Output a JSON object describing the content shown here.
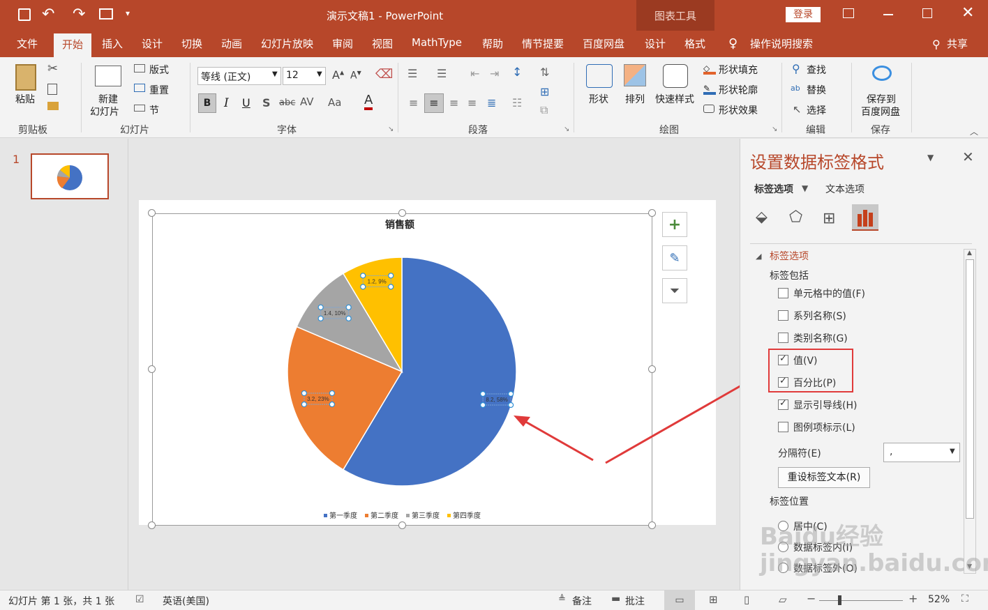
{
  "window": {
    "title": "演示文稿1  -  PowerPoint",
    "context_tools": "图表工具",
    "login": "登录"
  },
  "tabs": [
    "文件",
    "开始",
    "插入",
    "设计",
    "切换",
    "动画",
    "幻灯片放映",
    "审阅",
    "视图",
    "MathType",
    "帮助",
    "情节提要",
    "百度网盘",
    "设计",
    "格式"
  ],
  "tell_me": "操作说明搜索",
  "share": "共享",
  "ribbon": {
    "clipboard": {
      "paste": "粘贴",
      "label": "剪贴板"
    },
    "slides": {
      "new_slide_1": "新建",
      "new_slide_2": "幻灯片",
      "layout": "版式",
      "reset": "重置",
      "section": "节",
      "label": "幻灯片"
    },
    "font": {
      "font_name": "等线 (正文)",
      "font_size": "12",
      "label": "字体"
    },
    "paragraph": {
      "label": "段落"
    },
    "drawing": {
      "shape": "形状",
      "arrange": "排列",
      "quick_styles": "快速样式",
      "fill": "形状填充",
      "outline": "形状轮廓",
      "effects": "形状效果",
      "label": "绘图"
    },
    "editing": {
      "find": "查找",
      "replace": "替换",
      "select": "选择",
      "label": "编辑"
    },
    "save": {
      "save_1": "保存到",
      "save_2": "百度网盘",
      "label": "保存"
    }
  },
  "thumbnail": {
    "number": "1"
  },
  "chart_data": {
    "type": "pie",
    "title": "销售额",
    "categories": [
      "第一季度",
      "第二季度",
      "第三季度",
      "第四季度"
    ],
    "values": [
      8.2,
      3.2,
      1.4,
      1.2
    ],
    "percent_labels": [
      "8.2, 58%",
      "3.2, 23%",
      "1.4, 10%",
      "1.2, 9%"
    ],
    "colors": [
      "#4472c4",
      "#ed7d31",
      "#a5a5a5",
      "#ffc000"
    ],
    "legend_position": "bottom"
  },
  "pane": {
    "title": "设置数据标签格式",
    "tab_label_options": "标签选项",
    "tab_text_options": "文本选项",
    "section": "标签选项",
    "includes": "标签包括",
    "options": [
      {
        "label": "单元格中的值(F)",
        "checked": false
      },
      {
        "label": "系列名称(S)",
        "checked": false
      },
      {
        "label": "类别名称(G)",
        "checked": false
      },
      {
        "label": "值(V)",
        "checked": true
      },
      {
        "label": "百分比(P)",
        "checked": true
      },
      {
        "label": "显示引导线(H)",
        "checked": true
      },
      {
        "label": "图例项标示(L)",
        "checked": false
      }
    ],
    "separator_label": "分隔符(E)",
    "separator_value": ",",
    "reset_button": "重设标签文本(R)",
    "position_label": "标签位置",
    "positions": [
      "居中(C)",
      "数据标签内(I)",
      "数据标签外(O)"
    ]
  },
  "status": {
    "slide_info": "幻灯片 第 1 张，共 1 张",
    "language": "英语(美国)",
    "notes": "备注",
    "comments": "批注",
    "zoom": "52%"
  },
  "watermark": "Baidu经验 jingyan.baidu.com"
}
